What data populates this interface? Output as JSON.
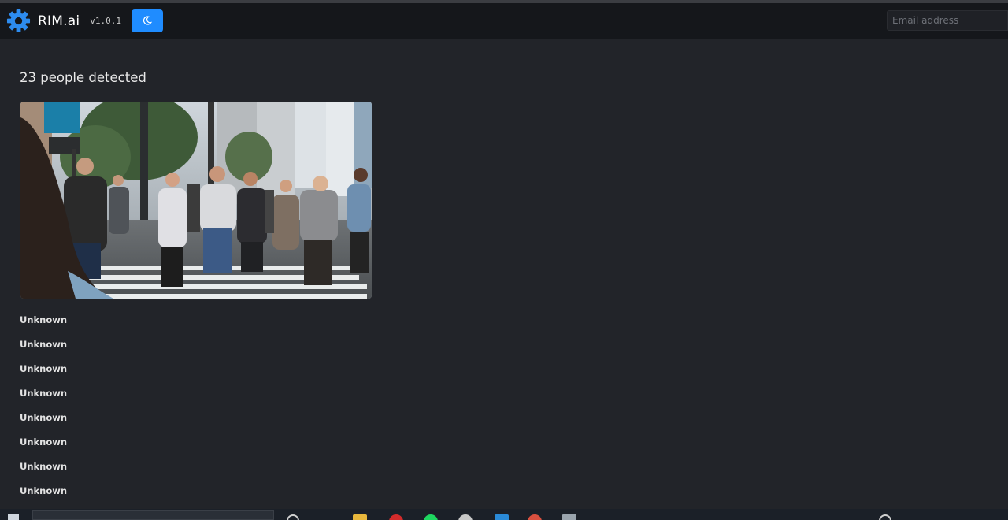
{
  "navbar": {
    "brand_icon": "gear-icon",
    "brand_name": "RIM.ai",
    "version": "v1.0.1",
    "theme_toggle_icon": "moon-icon",
    "email_placeholder": "Email address",
    "accent_color": "#1f8cff"
  },
  "main": {
    "heading": "23 people detected",
    "photo": "street-crosswalk-crowd-photo",
    "labels": [
      "Unknown",
      "Unknown",
      "Unknown",
      "Unknown",
      "Unknown",
      "Unknown",
      "Unknown",
      "Unknown"
    ]
  },
  "taskbar": {
    "icons": [
      "start-icon",
      "search-box",
      "cortana-icon",
      "file-explorer-icon",
      "opera-icon",
      "spotify-icon",
      "app-icon",
      "vscode-icon",
      "chrome-icon",
      "mail-icon",
      "network-icon"
    ]
  }
}
